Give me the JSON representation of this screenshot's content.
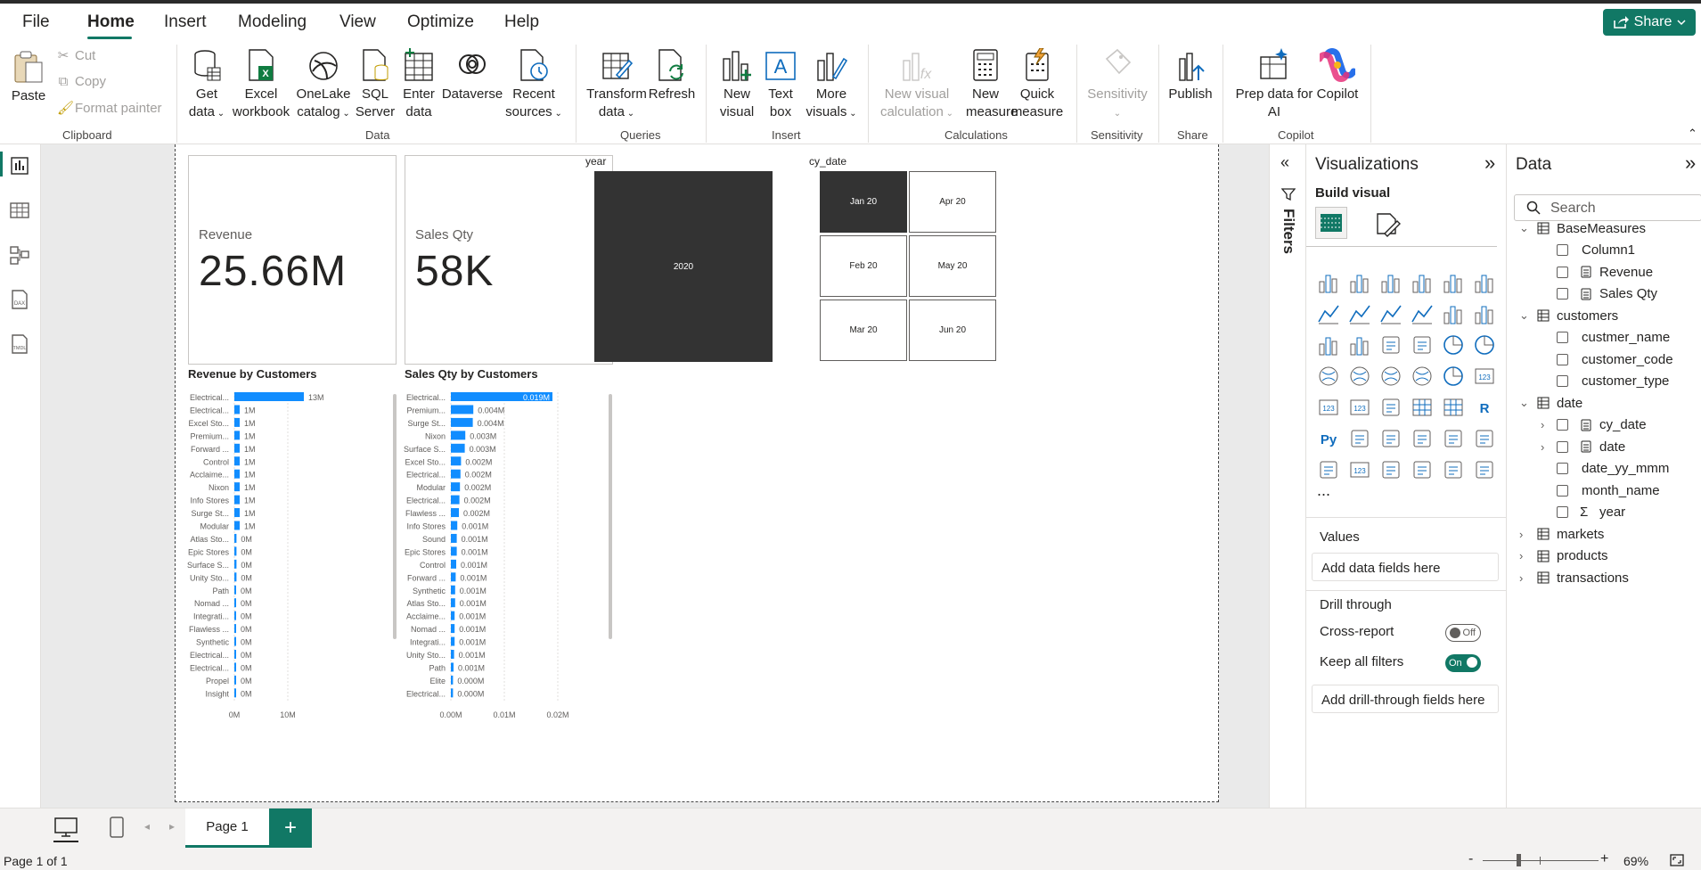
{
  "menu": {
    "items": [
      "File",
      "Home",
      "Insert",
      "Modeling",
      "View",
      "Optimize",
      "Help"
    ],
    "share_label": "Share"
  },
  "ribbon": {
    "paste": "Paste",
    "cut": "Cut",
    "copy": "Copy",
    "format_painter": "Format painter",
    "get_data": [
      "Get",
      "data"
    ],
    "excel": [
      "Excel",
      "workbook"
    ],
    "onelake": [
      "OneLake",
      "catalog"
    ],
    "sql": [
      "SQL",
      "Server"
    ],
    "enter_data": [
      "Enter",
      "data"
    ],
    "dataverse": "Dataverse",
    "recent": [
      "Recent",
      "sources"
    ],
    "transform": [
      "Transform",
      "data"
    ],
    "refresh": "Refresh",
    "new_visual": [
      "New",
      "visual"
    ],
    "text_box": [
      "Text",
      "box"
    ],
    "more_visuals": [
      "More",
      "visuals"
    ],
    "new_visual_calc": [
      "New visual",
      "calculation"
    ],
    "new_measure": [
      "New",
      "measure"
    ],
    "quick_measure": [
      "Quick",
      "measure"
    ],
    "sensitivity": "Sensitivity",
    "publish": "Publish",
    "prep_ai": [
      "Prep data for",
      "AI"
    ],
    "copilot": "Copilot",
    "groups": {
      "clipboard": "Clipboard",
      "data": "Data",
      "queries": "Queries",
      "insert": "Insert",
      "calculations": "Calculations",
      "sensitivity": "Sensitivity",
      "share": "Share",
      "copilot": "Copilot"
    }
  },
  "report": {
    "card_revenue": {
      "label": "Revenue",
      "value": "25.66M"
    },
    "card_qty": {
      "label": "Sales Qty",
      "value": "58K"
    },
    "year_slicer": {
      "title": "year",
      "tile": "2020"
    },
    "date_slicer": {
      "title": "cy_date",
      "tiles": [
        "Jan 20",
        "Apr 20",
        "Feb 20",
        "May 20",
        "Mar 20",
        "Jun 20"
      ],
      "selected": "Jan 20"
    }
  },
  "chart_data": [
    {
      "type": "bar",
      "title": "Revenue by Customers",
      "categories": [
        "Electrical...",
        "Electrical...",
        "Excel Sto...",
        "Premium...",
        "Forward ...",
        "Control",
        "Acclaime...",
        "Nixon",
        "Info Stores",
        "Surge St...",
        "Modular",
        "Atlas Sto...",
        "Epic Stores",
        "Surface S...",
        "Unity Sto...",
        "Path",
        "Nomad ...",
        "Integrati...",
        "Flawless ...",
        "Synthetic",
        "Electrical...",
        "Electrical...",
        "Propel",
        "Insight"
      ],
      "values": [
        13,
        1,
        1,
        1,
        1,
        1,
        1,
        1,
        1,
        1,
        1,
        0.4,
        0.4,
        0.4,
        0.4,
        0.3,
        0.3,
        0.3,
        0.3,
        0.3,
        0.2,
        0.2,
        0.2,
        0.2
      ],
      "data_labels": [
        "13M",
        "1M",
        "1M",
        "1M",
        "1M",
        "1M",
        "1M",
        "1M",
        "1M",
        "1M",
        "1M",
        "0M",
        "0M",
        "0M",
        "0M",
        "0M",
        "0M",
        "0M",
        "0M",
        "0M",
        "0M",
        "0M",
        "0M",
        "0M"
      ],
      "x_ticks": [
        "0M",
        "10M"
      ],
      "x_tick_values": [
        0,
        10
      ],
      "xlim": [
        0,
        20
      ],
      "color": "#118DFF"
    },
    {
      "type": "bar",
      "title": "Sales Qty by Customers",
      "categories": [
        "Electrical...",
        "Premium...",
        "Surge St...",
        "Nixon",
        "Surface S...",
        "Excel Sto...",
        "Electrical...",
        "Modular",
        "Electrical...",
        "Flawless ...",
        "Info Stores",
        "Sound",
        "Epic Stores",
        "Control",
        "Forward ...",
        "Synthetic",
        "Atlas Sto...",
        "Acclaime...",
        "Nomad ...",
        "Integrati...",
        "Unity Sto...",
        "Path",
        "Elite",
        "Electrical..."
      ],
      "values": [
        0.019,
        0.0042,
        0.0041,
        0.0027,
        0.0026,
        0.0019,
        0.0018,
        0.0017,
        0.0016,
        0.0015,
        0.0012,
        0.0011,
        0.0011,
        0.001,
        0.0009,
        0.0008,
        0.0008,
        0.0007,
        0.0007,
        0.0007,
        0.0006,
        0.0005,
        0.0004,
        0.0004
      ],
      "data_labels": [
        "0.019M",
        "0.004M",
        "0.004M",
        "0.003M",
        "0.003M",
        "0.002M",
        "0.002M",
        "0.002M",
        "0.002M",
        "0.002M",
        "0.001M",
        "0.001M",
        "0.001M",
        "0.001M",
        "0.001M",
        "0.001M",
        "0.001M",
        "0.001M",
        "0.001M",
        "0.001M",
        "0.001M",
        "0.001M",
        "0.000M",
        "0.000M"
      ],
      "x_ticks": [
        "0.00M",
        "0.01M",
        "0.02M"
      ],
      "x_tick_values": [
        0,
        0.01,
        0.02
      ],
      "xlim": [
        0,
        0.02
      ],
      "color": "#118DFF"
    }
  ],
  "filters_pane": {
    "label": "Filters"
  },
  "viz_pane": {
    "title": "Visualizations",
    "build_visual": "Build visual",
    "more": "...",
    "values_label": "Values",
    "values_placeholder": "Add data fields here",
    "drill_through": "Drill through",
    "cross_report": "Cross-report",
    "cross_report_state": "Off",
    "keep_filters": "Keep all filters",
    "keep_filters_state": "On",
    "drill_placeholder": "Add drill-through fields here",
    "icons": [
      "stacked-bar-chart-icon",
      "stacked-column-chart-icon",
      "clustered-bar-chart-icon",
      "clustered-column-chart-icon",
      "100-stacked-bar-chart-icon",
      "100-stacked-column-chart-icon",
      "line-chart-icon",
      "area-chart-icon",
      "stacked-area-chart-icon",
      "100-stacked-area-chart-icon",
      "line-and-stacked-column-icon",
      "line-and-clustered-column-icon",
      "ribbon-chart-icon",
      "waterfall-chart-icon",
      "funnel-chart-icon",
      "scatter-chart-icon",
      "pie-chart-icon",
      "donut-chart-icon",
      "treemap-icon",
      "map-icon",
      "filled-map-icon",
      "azure-map-icon",
      "gauge-icon",
      "card-icon",
      "multi-row-card-icon",
      "kpi-icon",
      "slicer-icon",
      "table-icon",
      "matrix-icon",
      "r-visual-icon",
      "python-visual-icon",
      "key-influencers-icon",
      "decomposition-tree-icon",
      "qa-icon",
      "smart-narrative-icon",
      "metrics-icon",
      "paginated-report-icon",
      "new-card-icon",
      "new-slicer-icon",
      "power-apps-icon",
      "power-automate-icon",
      "copilot-narrative-icon"
    ]
  },
  "data_pane": {
    "title": "Data",
    "search_placeholder": "Search",
    "tree": [
      {
        "label": "BaseMeasures",
        "level": 0,
        "kind": "table",
        "expanded": true
      },
      {
        "label": "Column1",
        "level": 1,
        "kind": "column"
      },
      {
        "label": "Revenue",
        "level": 1,
        "kind": "measure"
      },
      {
        "label": "Sales Qty",
        "level": 1,
        "kind": "measure"
      },
      {
        "label": "customers",
        "level": 0,
        "kind": "table",
        "expanded": true
      },
      {
        "label": "custmer_name",
        "level": 1,
        "kind": "column"
      },
      {
        "label": "customer_code",
        "level": 1,
        "kind": "column"
      },
      {
        "label": "customer_type",
        "level": 1,
        "kind": "column"
      },
      {
        "label": "date",
        "level": 0,
        "kind": "table",
        "expanded": true
      },
      {
        "label": "cy_date",
        "level": 1,
        "kind": "hierarchy"
      },
      {
        "label": "date",
        "level": 1,
        "kind": "hierarchy"
      },
      {
        "label": "date_yy_mmm",
        "level": 1,
        "kind": "column"
      },
      {
        "label": "month_name",
        "level": 1,
        "kind": "column"
      },
      {
        "label": "year",
        "level": 1,
        "kind": "sum"
      },
      {
        "label": "markets",
        "level": 0,
        "kind": "table",
        "expanded": false
      },
      {
        "label": "products",
        "level": 0,
        "kind": "table",
        "expanded": false
      },
      {
        "label": "transactions",
        "level": 0,
        "kind": "table",
        "expanded": false
      }
    ]
  },
  "tabs": {
    "page1": "Page 1",
    "add": "+"
  },
  "status": {
    "page": "Page 1 of 1",
    "zoom": "69%",
    "minus": "-",
    "plus": "+"
  },
  "colors": {
    "accent": "#117865",
    "bar": "#118DFF",
    "selected_tile": "#333333"
  }
}
